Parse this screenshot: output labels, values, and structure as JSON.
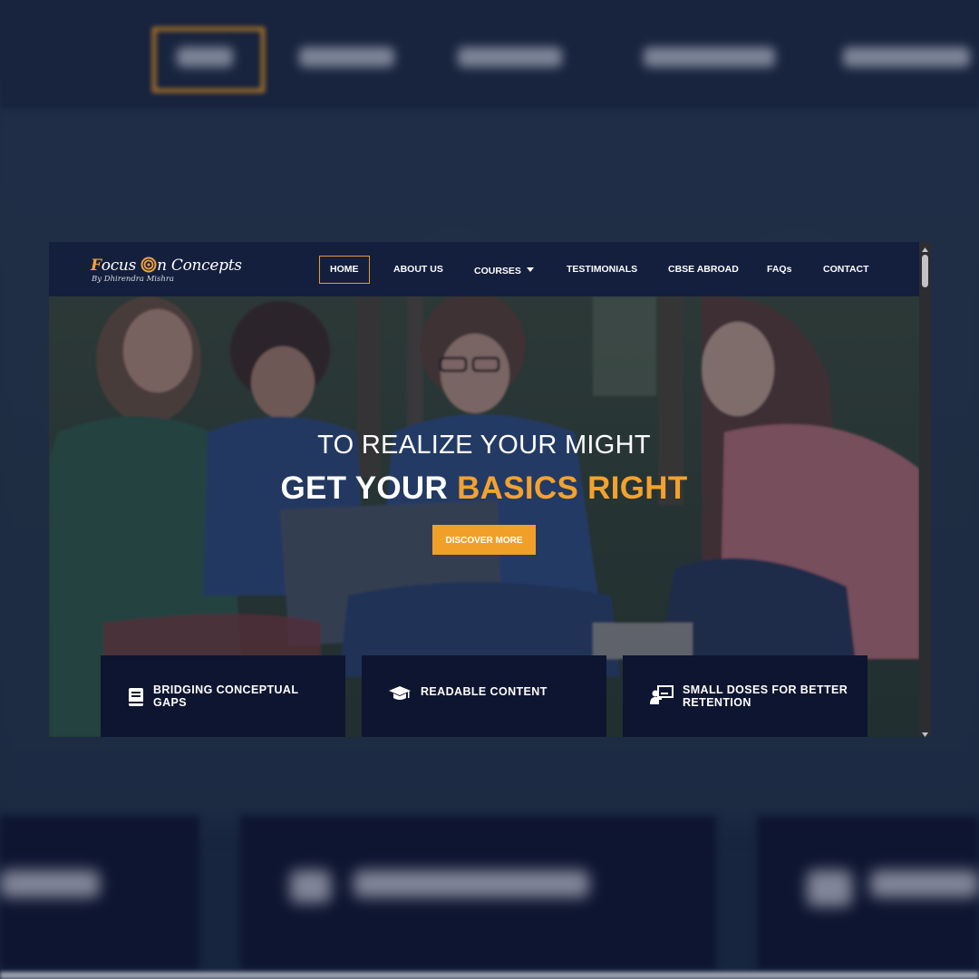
{
  "logo": {
    "brand_part1": "F",
    "brand_part2": "ocus",
    "brand_part3": "n Concepts",
    "tagline": "By Dhirendra Mishra"
  },
  "nav": {
    "items": [
      {
        "label": "HOME",
        "active": true
      },
      {
        "label": "ABOUT US"
      },
      {
        "label": "COURSES",
        "has_dropdown": true
      },
      {
        "label": "TESTIMONIALS"
      },
      {
        "label": "CBSE ABROAD"
      },
      {
        "label": "FAQs"
      },
      {
        "label": "CONTACT"
      }
    ]
  },
  "hero": {
    "line1": "TO REALIZE YOUR MIGHT",
    "line2_white": "GET YOUR",
    "line2_orange": "BASICS RIGHT",
    "cta_label": "DISCOVER MORE"
  },
  "features": [
    {
      "label": "BRIDGING CONCEPTUAL GAPS",
      "icon": "book-icon"
    },
    {
      "label": "READABLE CONTENT",
      "icon": "graduation-cap-icon"
    },
    {
      "label": "SMALL DOSES FOR BETTER RETENTION",
      "icon": "teacher-board-icon"
    }
  ],
  "colors": {
    "navy": "#141f3d",
    "card": "#0e1530",
    "accent": "#f0a028"
  }
}
